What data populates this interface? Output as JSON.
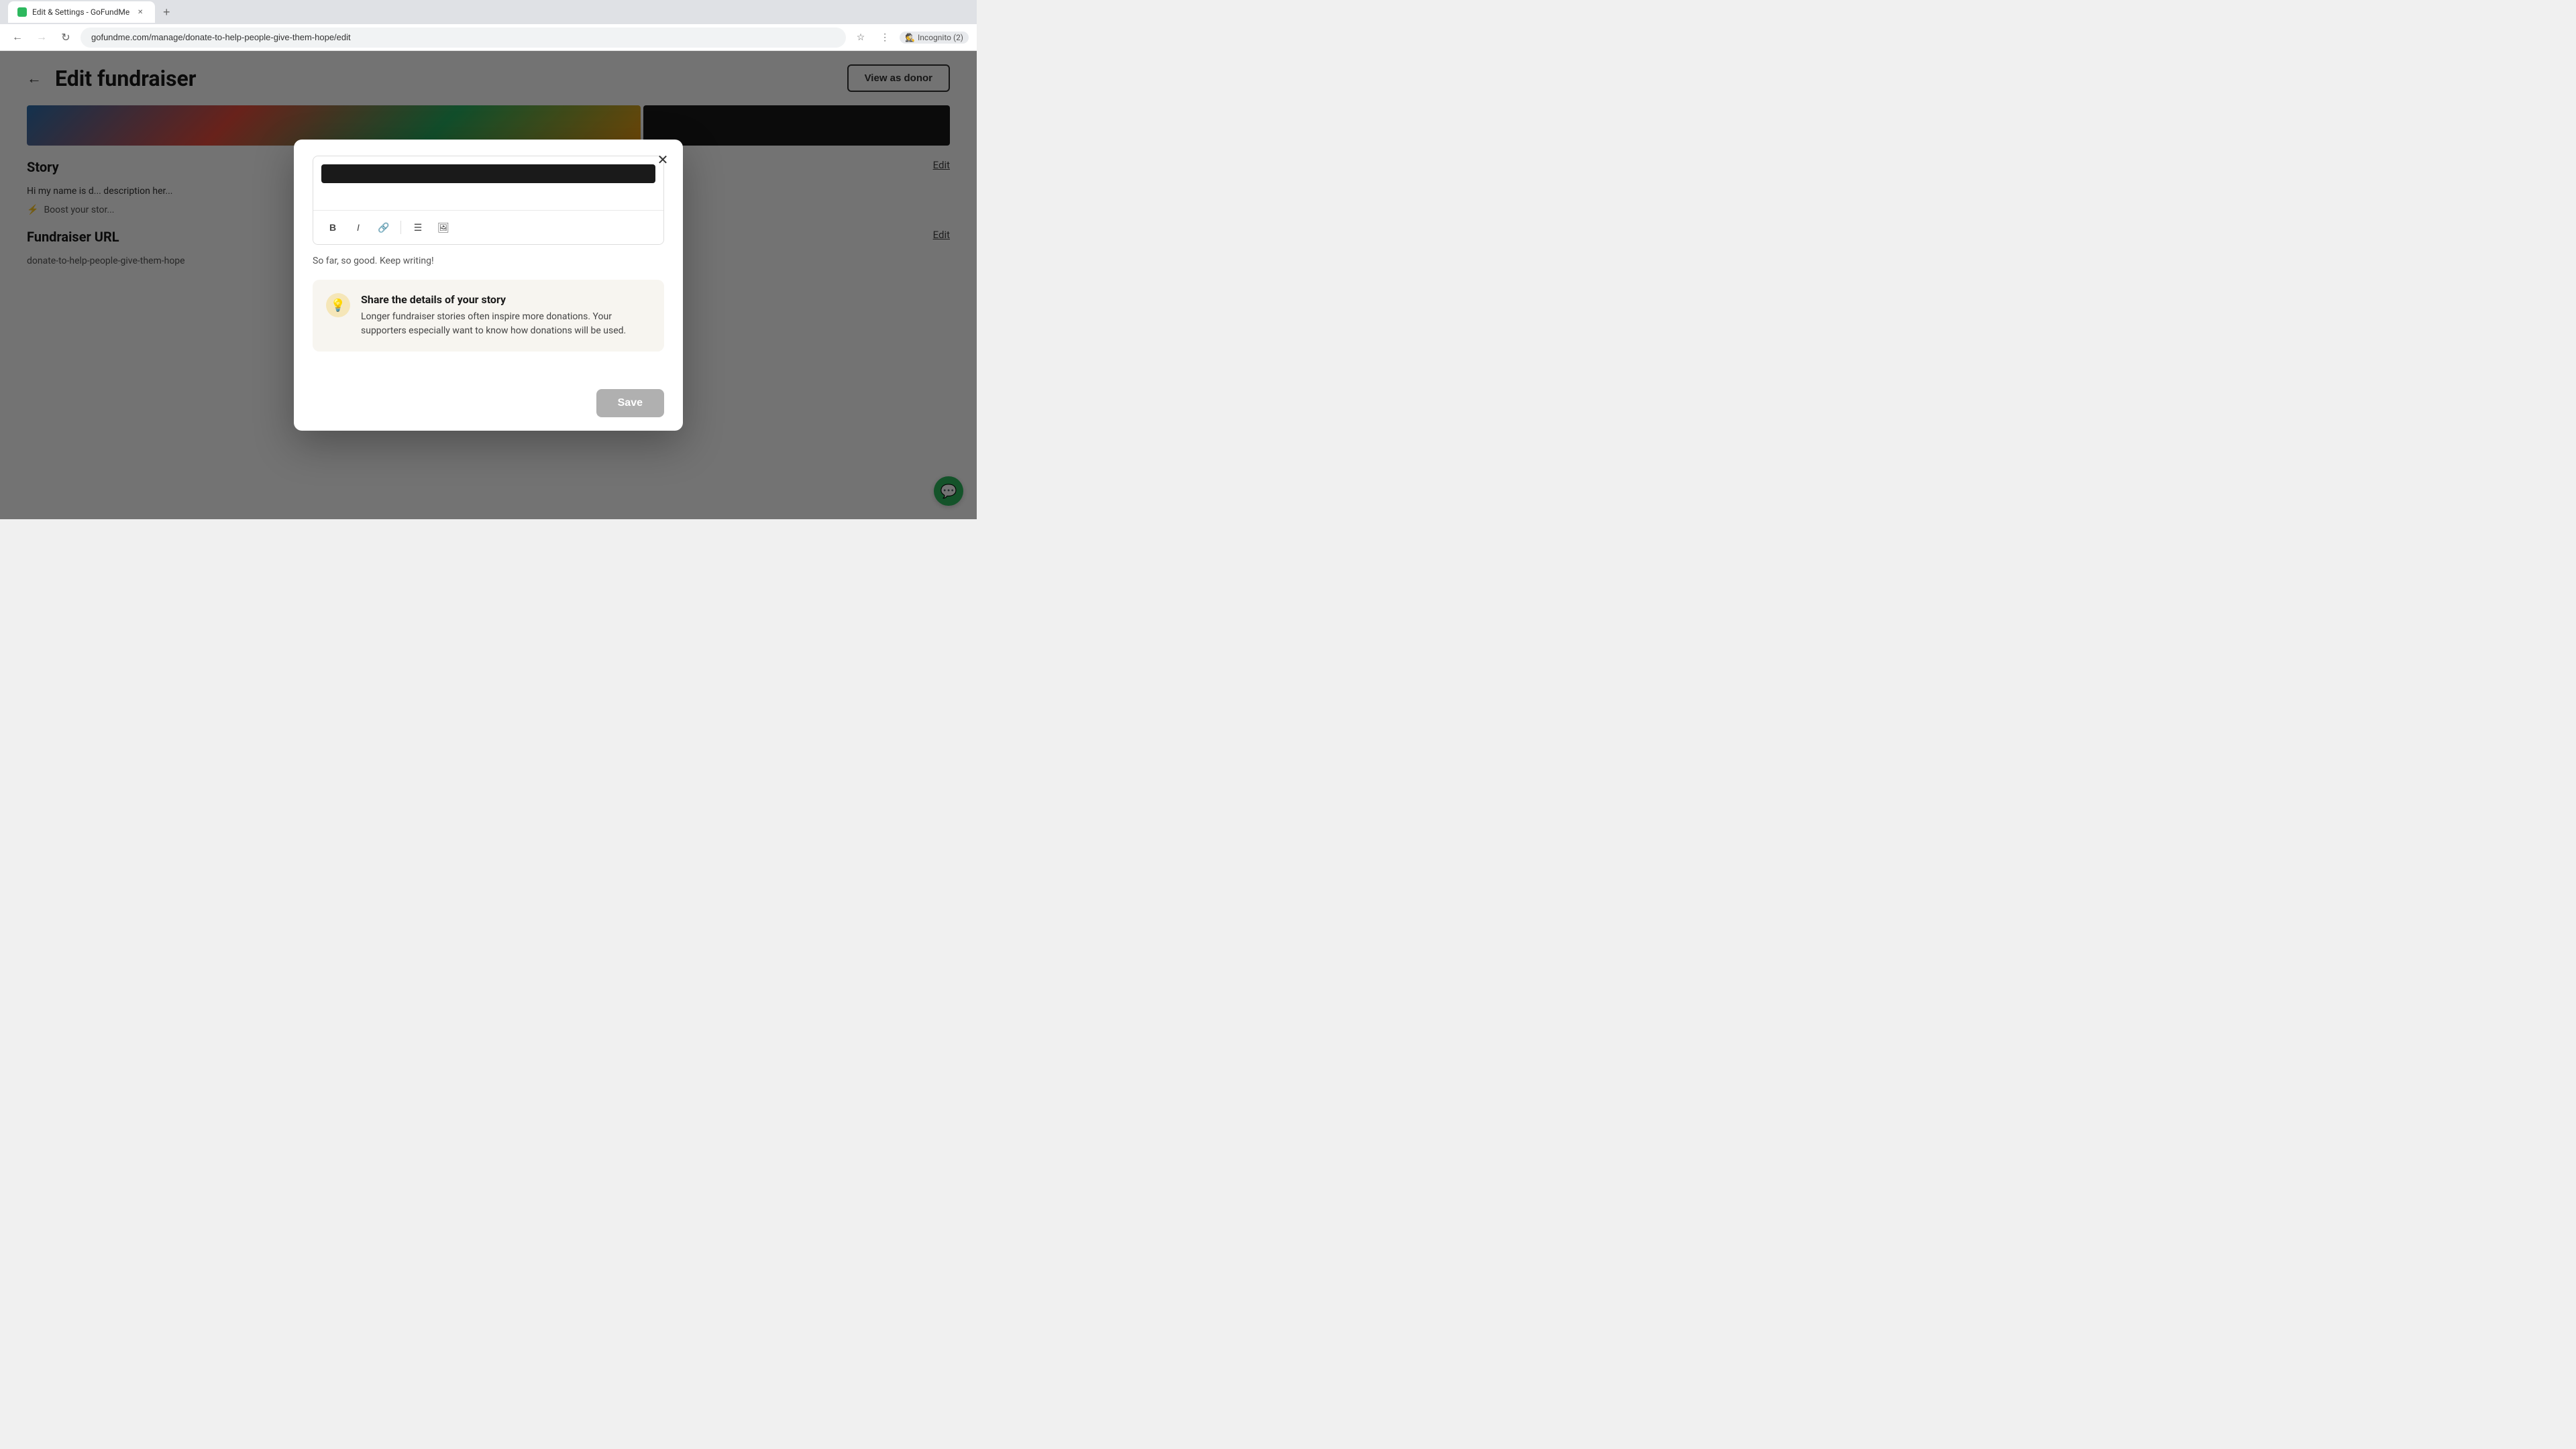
{
  "browser": {
    "tab_label": "Edit & Settings - GoFundMe",
    "url": "gofundme.com/manage/donate-to-help-people-give-them-hope/edit",
    "incognito_label": "Incognito (2)"
  },
  "page": {
    "back_label": "←",
    "title": "Edit fundraiser",
    "view_as_donor_label": "View as donor"
  },
  "story_section": {
    "label": "Story",
    "edit_label": "Edit",
    "text": "Hi my name is d... description her..."
  },
  "boost_section": {
    "text": "Boost your stor..."
  },
  "url_section": {
    "label": "Fundraiser URL",
    "edit_label": "Edit",
    "url_value": "donate-to-help-people-give-them-hope"
  },
  "modal": {
    "close_label": "✕",
    "feedback_text": "So far, so good. Keep writing!",
    "tip": {
      "icon": "💡",
      "title": "Share the details of your story",
      "body": "Longer fundraiser stories often inspire more donations. Your supporters especially want to know how donations will be used."
    },
    "save_label": "Save"
  },
  "toolbar": {
    "bold_label": "B",
    "italic_label": "I",
    "link_label": "🔗",
    "list_label": "☰",
    "image_label": "🖼"
  },
  "chat": {
    "icon": "💬"
  }
}
